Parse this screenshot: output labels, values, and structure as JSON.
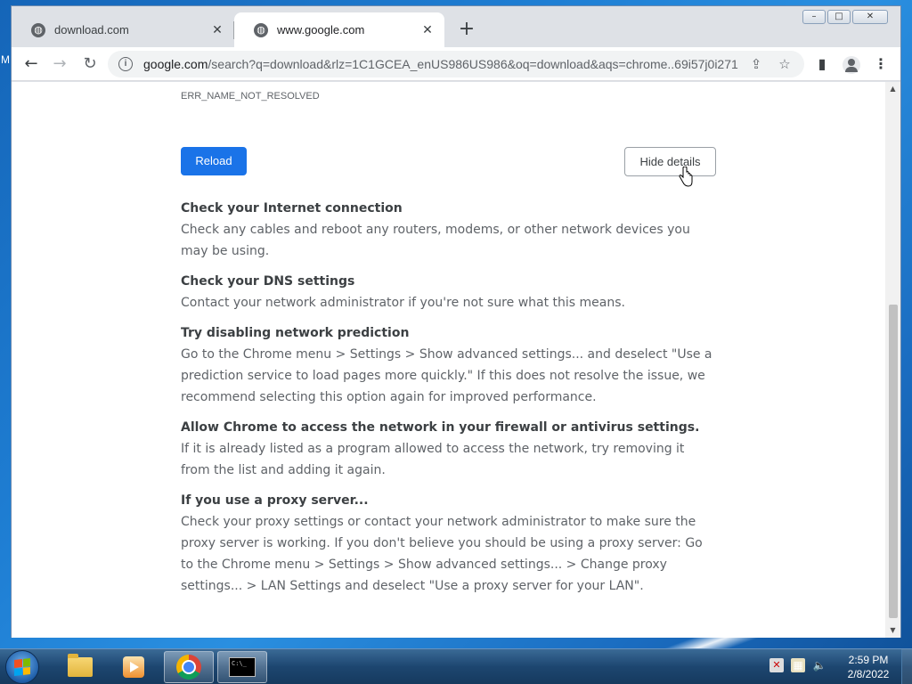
{
  "desktop": {
    "edge_letter": "M"
  },
  "browser": {
    "tabs": [
      {
        "title": "download.com",
        "active": false
      },
      {
        "title": "www.google.com",
        "active": true
      }
    ],
    "new_tab_label": "+",
    "window_controls": {
      "minimize": "–",
      "restore": "□",
      "close": "✕"
    },
    "address": {
      "host": "google.com",
      "path": "/search?q=download&rlz=1C1GCEA_enUS986US986&oq=download&aqs=chrome..69i57j0i271..."
    }
  },
  "error_page": {
    "error_code": "ERR_NAME_NOT_RESOLVED",
    "reload_label": "Reload",
    "details_label": "Hide details",
    "suggestions": [
      {
        "heading": "Check your Internet connection",
        "body": "Check any cables and reboot any routers, modems, or other network devices you may be using."
      },
      {
        "heading": "Check your DNS settings",
        "body": "Contact your network administrator if you're not sure what this means."
      },
      {
        "heading": "Try disabling network prediction",
        "body": "Go to the Chrome menu > Settings > Show advanced settings... and deselect \"Use a prediction service to load pages more quickly.\" If this does not resolve the issue, we recommend selecting this option again for improved performance."
      },
      {
        "heading": "Allow Chrome to access the network in your firewall or antivirus settings.",
        "body": "If it is already listed as a program allowed to access the network, try removing it from the list and adding it again."
      },
      {
        "heading": "If you use a proxy server...",
        "body": "Check your proxy settings or contact your network administrator to make sure the proxy server is working. If you don't believe you should be using a proxy server: Go to the Chrome menu > Settings > Show advanced settings... > Change proxy settings... > LAN Settings and deselect \"Use a proxy server for your LAN\"."
      }
    ]
  },
  "taskbar": {
    "apps": [
      "file-explorer",
      "media-player",
      "chrome",
      "command-prompt"
    ],
    "active_app": "chrome",
    "cmd_icon_text": "C:\\_",
    "clock_time": "2:59 PM",
    "clock_date": "2/8/2022"
  }
}
